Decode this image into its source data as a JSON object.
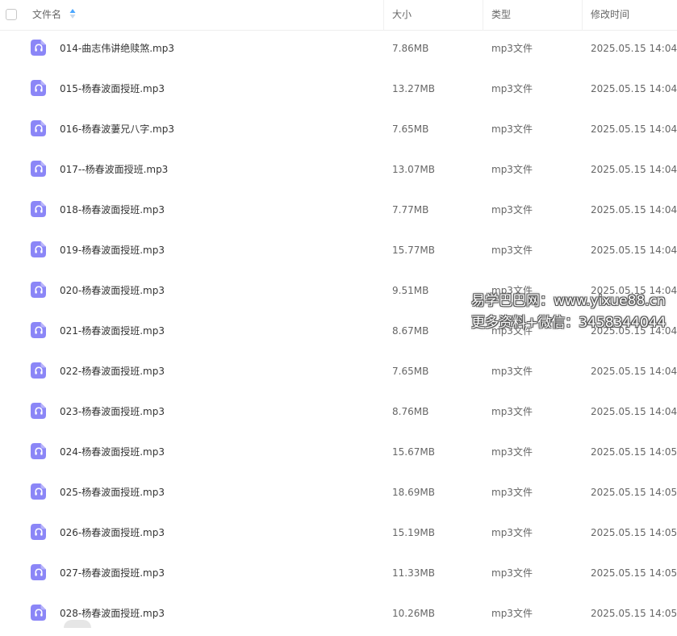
{
  "header": {
    "name_label": "文件名",
    "size_label": "大小",
    "type_label": "类型",
    "modified_label": "修改时间"
  },
  "colors": {
    "icon_bg": "#8b86f7",
    "sort_arrow_active": "#4aa6ff",
    "sort_arrow_inactive": "#c8d8ea"
  },
  "files": [
    {
      "name": "014-曲志伟讲绝赎煞.mp3",
      "size": "7.86MB",
      "type": "mp3文件",
      "modified": "2025.05.15 14:04"
    },
    {
      "name": "015-杨春波面授班.mp3",
      "size": "13.27MB",
      "type": "mp3文件",
      "modified": "2025.05.15 14:04"
    },
    {
      "name": "016-杨春波萋兄八字.mp3",
      "size": "7.65MB",
      "type": "mp3文件",
      "modified": "2025.05.15 14:04"
    },
    {
      "name": "017--杨春波面授班.mp3",
      "size": "13.07MB",
      "type": "mp3文件",
      "modified": "2025.05.15 14:04"
    },
    {
      "name": "018-杨春波面授班.mp3",
      "size": "7.77MB",
      "type": "mp3文件",
      "modified": "2025.05.15 14:04"
    },
    {
      "name": "019-杨春波面授班.mp3",
      "size": "15.77MB",
      "type": "mp3文件",
      "modified": "2025.05.15 14:04"
    },
    {
      "name": "020-杨春波面授班.mp3",
      "size": "9.51MB",
      "type": "mp3文件",
      "modified": "2025.05.15 14:04"
    },
    {
      "name": "021-杨春波面授班.mp3",
      "size": "8.67MB",
      "type": "mp3文件",
      "modified": "2025.05.15 14:04"
    },
    {
      "name": "022-杨春波面授班.mp3",
      "size": "7.65MB",
      "type": "mp3文件",
      "modified": "2025.05.15 14:04"
    },
    {
      "name": "023-杨春波面授班.mp3",
      "size": "8.76MB",
      "type": "mp3文件",
      "modified": "2025.05.15 14:04"
    },
    {
      "name": "024-杨春波面授班.mp3",
      "size": "15.67MB",
      "type": "mp3文件",
      "modified": "2025.05.15 14:05"
    },
    {
      "name": "025-杨春波面授班.mp3",
      "size": "18.69MB",
      "type": "mp3文件",
      "modified": "2025.05.15 14:05"
    },
    {
      "name": "026-杨春波面授班.mp3",
      "size": "15.19MB",
      "type": "mp3文件",
      "modified": "2025.05.15 14:05"
    },
    {
      "name": "027-杨春波面授班.mp3",
      "size": "11.33MB",
      "type": "mp3文件",
      "modified": "2025.05.15 14:05"
    },
    {
      "name": "028-杨春波面授班.mp3",
      "size": "10.26MB",
      "type": "mp3文件",
      "modified": "2025.05.15 14:05"
    }
  ],
  "watermark": {
    "line1": "易学巴巴网：www.yixue88.cn",
    "line2": "更多资料+微信：3458344044"
  }
}
